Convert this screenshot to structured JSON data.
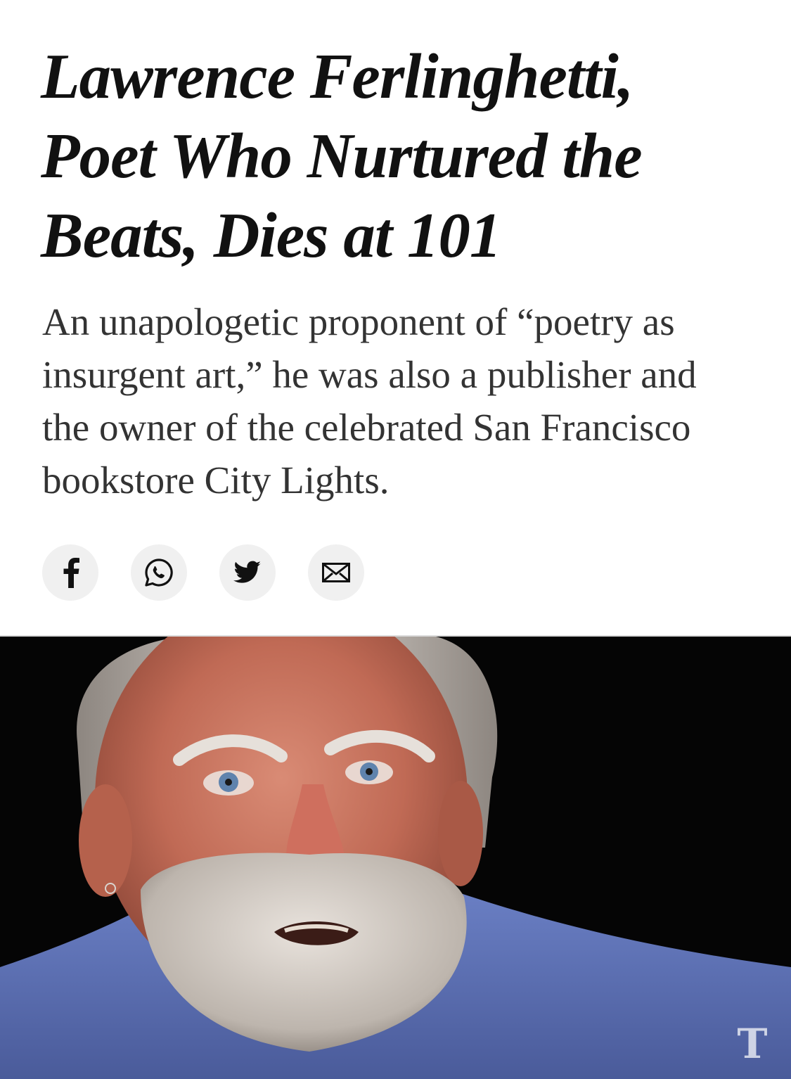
{
  "article": {
    "headline": "Lawrence Ferlinghetti, Poet Who Nurtured the Beats, Dies at 101",
    "summary": "An unapologetic proponent of “poetry as insurgent art,” he was also a publisher and the owner of the celebrated San Francisco bookstore City Lights."
  },
  "share": {
    "buttons": [
      {
        "icon": "facebook-icon"
      },
      {
        "icon": "whatsapp-icon"
      },
      {
        "icon": "twitter-icon"
      },
      {
        "icon": "email-icon"
      }
    ]
  },
  "media": {
    "watermark": "T"
  },
  "colors": {
    "headline": "#111111",
    "summary": "#333333",
    "share_button_bg": "#f0f0f0",
    "media_bg": "#050505",
    "shirt": "#5a6fb4"
  }
}
